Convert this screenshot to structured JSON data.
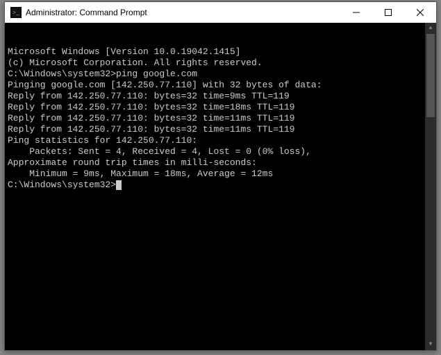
{
  "window": {
    "title": "Administrator: Command Prompt"
  },
  "terminal": {
    "lines": [
      "Microsoft Windows [Version 10.0.19042.1415]",
      "(c) Microsoft Corporation. All rights reserved.",
      "",
      "C:\\Windows\\system32>ping google.com",
      "",
      "Pinging google.com [142.250.77.110] with 32 bytes of data:",
      "Reply from 142.250.77.110: bytes=32 time=9ms TTL=119",
      "Reply from 142.250.77.110: bytes=32 time=18ms TTL=119",
      "Reply from 142.250.77.110: bytes=32 time=11ms TTL=119",
      "Reply from 142.250.77.110: bytes=32 time=11ms TTL=119",
      "",
      "Ping statistics for 142.250.77.110:",
      "    Packets: Sent = 4, Received = 4, Lost = 0 (0% loss),",
      "Approximate round trip times in milli-seconds:",
      "    Minimum = 9ms, Maximum = 18ms, Average = 12ms",
      "",
      "C:\\Windows\\system32>"
    ],
    "prompt_cursor_line_index": 16
  }
}
